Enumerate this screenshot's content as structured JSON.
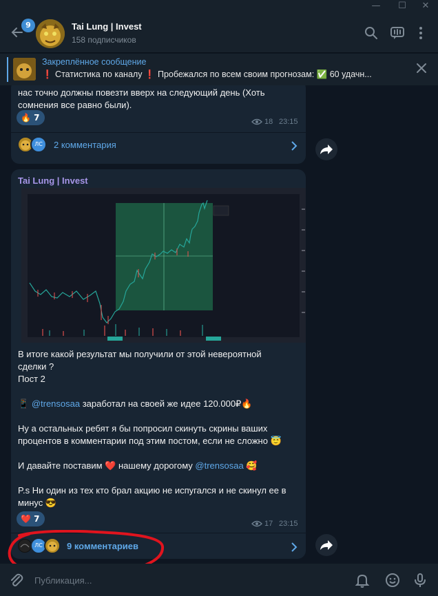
{
  "window": {
    "minimize": "—",
    "maximize": "☐",
    "close": "✕"
  },
  "header": {
    "unread_count": "9",
    "channel_title": "Tai Lung | Invest",
    "subscribers": "158 подписчиков"
  },
  "pinned": {
    "title": "Закреплённое сообщение",
    "text": "❗ Статистика по каналу ❗ Пробежался по всем своим прогнозам: ✅ 60 удачн..."
  },
  "messages": [
    {
      "text_line1": "нас точно должны повезти вверх на следующий день (Хоть",
      "text_line2": "сомнения все равно были).",
      "reaction_emoji": "🔥",
      "reaction_count": "7",
      "views": "18",
      "time": "23:15",
      "avatar_ls": "ЛС",
      "comments": "2 комментария"
    },
    {
      "author": "Tai Lung | Invest",
      "line1": "В итоге какой результат мы получили от этой невероятной",
      "line2": "сделки ?",
      "line3": " Пост 2",
      "line4_prefix": "📱 ",
      "mention1": "@trensosaa",
      "line4_suffix": " заработал на своей же идее 120.000₽🔥",
      "line5": "Ну а остальных ребят я бы попросил скинуть скрины ваших",
      "line6": "процентов в комментарии под этим постом, если не сложно 😇",
      "line7_prefix": "И давайте поставим ❤️ нашему дорогому ",
      "mention2": "@trensosaa",
      "line7_suffix": " 🥰",
      "line8": "P.s Ни один из тех кто брал акцию не испугался и не скинул ее в",
      "line9": "минус 😎",
      "reaction_emoji": "❤️",
      "reaction_count": "7",
      "views": "17",
      "time": "23:15",
      "avatar_ls": "ЛС",
      "comments": "9 комментариев"
    }
  ],
  "composer": {
    "placeholder": "Публикация..."
  },
  "colors": {
    "accent": "#5fa8e8",
    "bubble": "#182533",
    "bg": "#0e1621",
    "annotation": "#e0141e"
  }
}
